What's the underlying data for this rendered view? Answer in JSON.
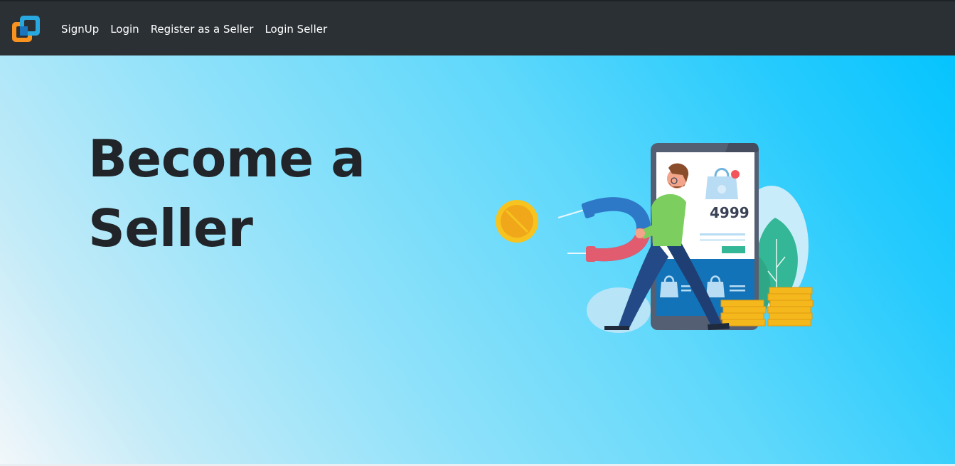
{
  "navbar": {
    "logo_icon": "overlapping-squares-logo-icon",
    "links": [
      "SignUp",
      "Login",
      "Register as a Seller",
      "Login Seller"
    ]
  },
  "hero": {
    "title": "Become a Seller",
    "illustration": {
      "price_text": "4999",
      "icon": "seller-magnet-coins-illustration"
    }
  },
  "colors": {
    "navbar_bg": "#2b3035",
    "title_color": "#212529",
    "hero_gradient_start": "#f2f7fa",
    "hero_gradient_end": "#05c4fe"
  }
}
